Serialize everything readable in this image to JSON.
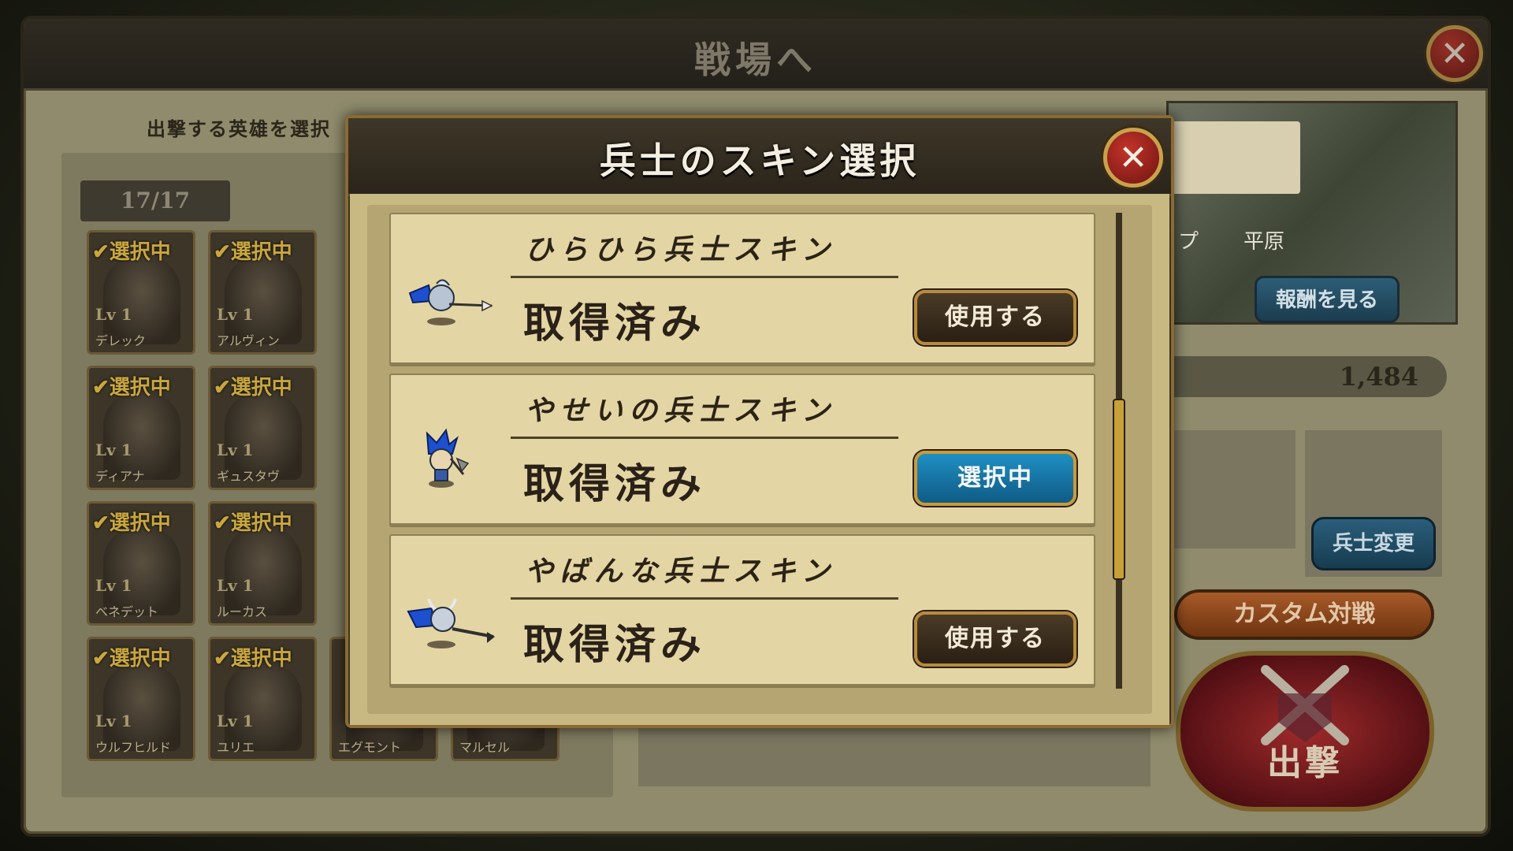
{
  "background_screen": {
    "title": "戦場へ",
    "hero_select_label": "出撃する英雄を選択",
    "hero_count": "17/17",
    "heroes": [
      {
        "status": "選択中",
        "level": "Lv 1",
        "name": "デレック"
      },
      {
        "status": "選択中",
        "level": "Lv 1",
        "name": "アルヴィン"
      },
      {
        "status": "選択中",
        "level": "Lv 1",
        "name": "ディアナ"
      },
      {
        "status": "選択中",
        "level": "Lv 1",
        "name": "ギュスタヴ"
      },
      {
        "status": "選択中",
        "level": "Lv 1",
        "name": "ベネデット"
      },
      {
        "status": "選択中",
        "level": "Lv 1",
        "name": "ルーカス"
      },
      {
        "status": "選択中",
        "level": "Lv 1",
        "name": "ウルフヒルド"
      },
      {
        "status": "選択中",
        "level": "Lv 1",
        "name": "ユリエ"
      }
    ],
    "partial_names": [
      "エグモント",
      "マルセル"
    ],
    "map_labels": [
      "プ",
      "平原"
    ],
    "reward_button": "報酬を見る",
    "power_value": "1,484",
    "change_soldier_button": "兵士変更",
    "custom_battle_button": "カスタム対戦",
    "sortie_button": "出撃"
  },
  "modal": {
    "title": "兵士のスキン選択",
    "close_icon": "close-icon",
    "skins": [
      {
        "name": "ひらひら兵士スキン",
        "status": "取得済み",
        "button": "使用する",
        "active": false
      },
      {
        "name": "やせいの兵士スキン",
        "status": "取得済み",
        "button": "選択中",
        "active": true
      },
      {
        "name": "やばんな兵士スキン",
        "status": "取得済み",
        "button": "使用する",
        "active": false
      }
    ]
  },
  "colors": {
    "accent_gold": "#c9a24d",
    "active_blue": "#1f8fc2",
    "close_red": "#c3342a"
  }
}
